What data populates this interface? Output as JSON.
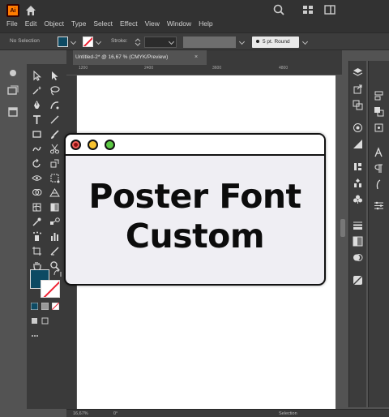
{
  "app": {
    "logo_text": "Ai",
    "menus": [
      "File",
      "Edit",
      "Object",
      "Type",
      "Select",
      "Effect",
      "View",
      "Window",
      "Help"
    ]
  },
  "control_bar": {
    "selection_label": "No Selection",
    "stroke_label": "Stroke:",
    "brush_label": "5 pt. Round",
    "fill_color": "#0d4a63"
  },
  "document": {
    "tab_title": "Untitled-2* @ 16,67 % (CMYK/Preview)",
    "close_glyph": "×",
    "ruler_marks": [
      "1200",
      "2400",
      "3600",
      "4800"
    ]
  },
  "status_bar": {
    "zoom": "16,67%",
    "rotation": "0°",
    "tool": "Selection"
  },
  "overlay_window": {
    "line1": "Poster Font",
    "line2": "Custom",
    "dot_colors": [
      "#f25f58",
      "#f7c22f",
      "#5cc844"
    ]
  },
  "icons": {
    "top_right": [
      "search-icon",
      "arrange-documents-icon",
      "workspace-switcher-icon"
    ],
    "tools": [
      "selection-tool-icon",
      "direct-selection-tool-icon",
      "magic-wand-tool-icon",
      "lasso-tool-icon",
      "pen-tool-icon",
      "curvature-tool-icon",
      "type-tool-icon",
      "line-tool-icon",
      "rectangle-tool-icon",
      "paintbrush-tool-icon",
      "shaper-tool-icon",
      "scissors-tool-icon",
      "rotate-tool-icon",
      "scale-tool-icon",
      "width-tool-icon",
      "free-transform-tool-icon",
      "shape-builder-tool-icon",
      "perspective-grid-tool-icon",
      "mesh-tool-icon",
      "gradient-tool-icon",
      "eyedropper-tool-icon",
      "blend-tool-icon",
      "symbol-sprayer-tool-icon",
      "column-graph-tool-icon",
      "artboard-tool-icon",
      "slice-tool-icon",
      "hand-tool-icon",
      "zoom-tool-icon"
    ]
  }
}
